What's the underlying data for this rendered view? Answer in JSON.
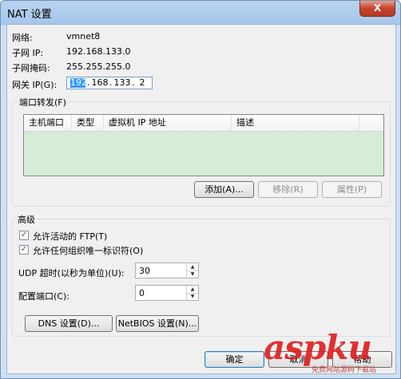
{
  "window": {
    "title": "NAT 设置",
    "close": "X"
  },
  "info": {
    "network_label": "网络:",
    "network_value": "vmnet8",
    "subnet_ip_label": "子网 IP:",
    "subnet_ip_value": "192.168.133.0",
    "subnet_mask_label": "子网掩码:",
    "subnet_mask_value": "255.255.255.0",
    "gateway_label": "网关 IP(G):",
    "gateway_octets": [
      "192",
      "168",
      "133",
      "2"
    ]
  },
  "port_forwarding": {
    "legend": "端口转发(F)",
    "columns": [
      "主机端口",
      "类型",
      "虚拟机 IP 地址",
      "描述"
    ],
    "rows": [],
    "buttons": {
      "add": "添加(A)...",
      "remove": "移除(R)",
      "properties": "属性(P)"
    }
  },
  "advanced": {
    "legend": "高级",
    "allow_ftp": {
      "label": "允许活动的 FTP(T)",
      "checked": true
    },
    "allow_uid": {
      "label": "允许任何组织唯一标识符(O)",
      "checked": true
    },
    "udp_timeout_label": "UDP 超时(以秒为单位)(U):",
    "udp_timeout_value": "30",
    "config_port_label": "配置端口(C):",
    "config_port_value": "0",
    "dns_button": "DNS 设置(D)...",
    "netbios_button": "NetBIOS 设置(N)..."
  },
  "footer": {
    "ok": "确定",
    "cancel": "取消",
    "help": "帮助"
  },
  "watermark": {
    "text": "aspku",
    "sub": "免费网站源码下载站",
    "color": "#e02020"
  }
}
